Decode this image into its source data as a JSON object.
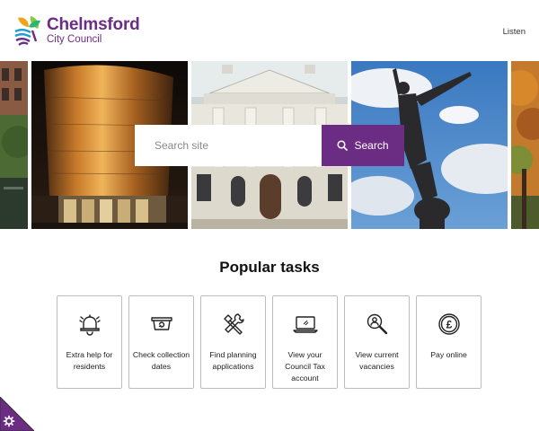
{
  "header": {
    "logo_name": "Chelmsford",
    "logo_sub": "City Council",
    "listen_label": "Listen"
  },
  "hero": {
    "images": [
      "building-photo",
      "copper-theatre-photo",
      "shire-hall-photo",
      "statue-photo",
      "autumn-tree-photo"
    ]
  },
  "search": {
    "placeholder": "Search site",
    "button_label": "Search"
  },
  "popular": {
    "title": "Popular tasks",
    "tasks": [
      {
        "label": "Extra help for residents",
        "icon": "bell-icon"
      },
      {
        "label": "Check collection dates",
        "icon": "bin-icon"
      },
      {
        "label": "Find planning applications",
        "icon": "tools-icon"
      },
      {
        "label": "View your Council Tax account",
        "icon": "laptop-icon"
      },
      {
        "label": "View current vacancies",
        "icon": "magnifier-icon"
      },
      {
        "label": "Pay online",
        "icon": "pound-coin-icon"
      }
    ]
  },
  "accessibility": {
    "icon": "gear-icon"
  },
  "colors": {
    "brand_purple": "#6b2c84",
    "card_border": "#bdbdbd"
  }
}
